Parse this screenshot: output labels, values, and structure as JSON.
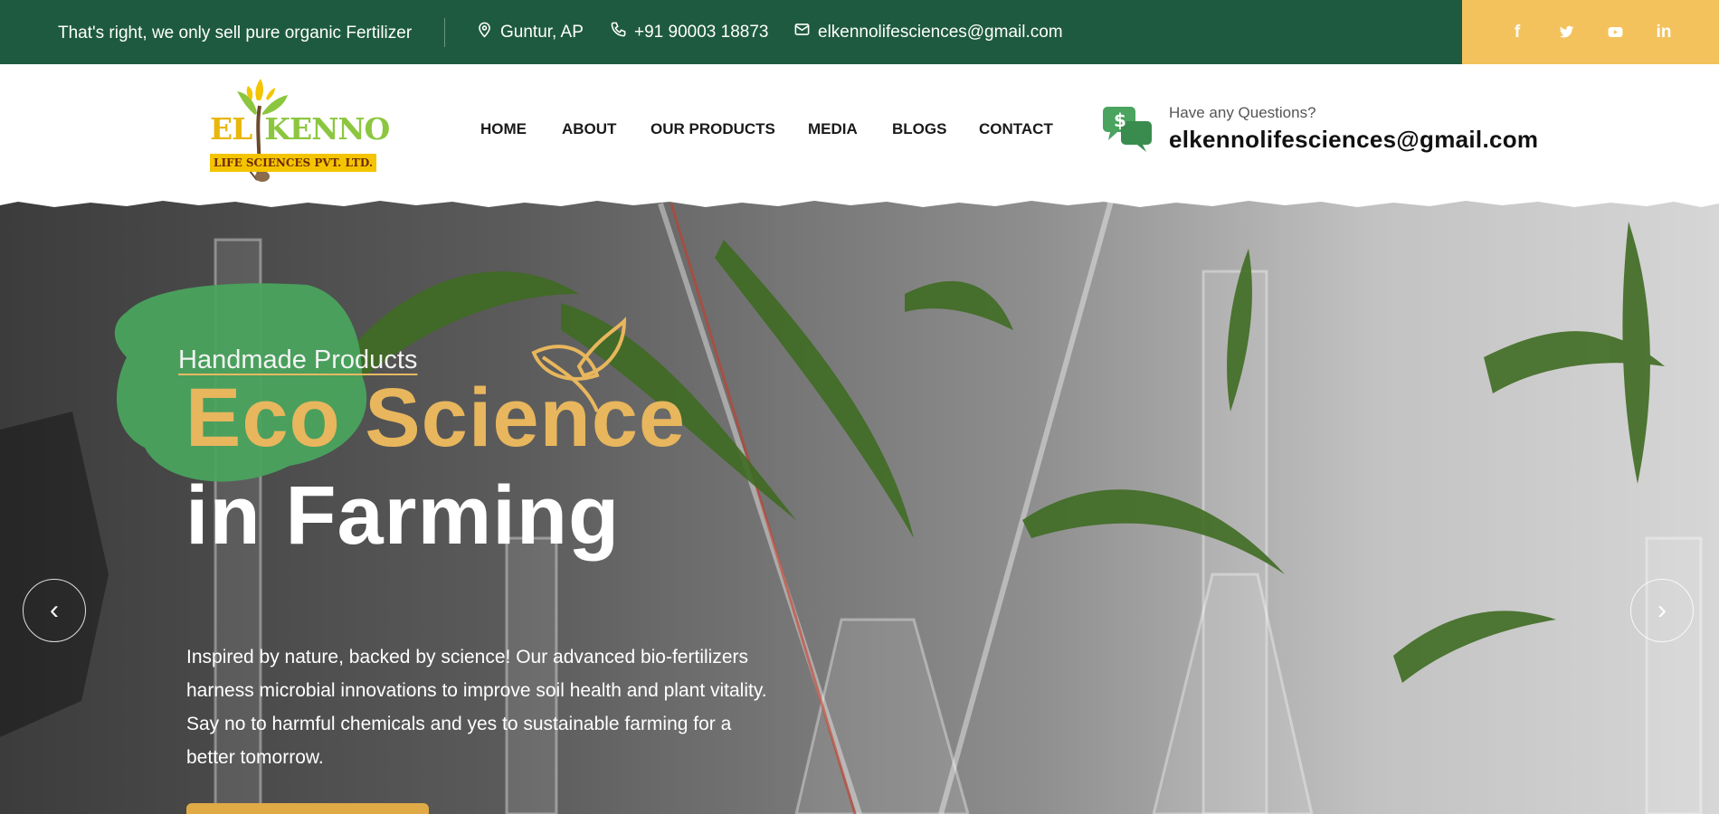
{
  "topbar": {
    "tagline": "That's right, we only sell pure organic Fertilizer",
    "location": "Guntur, AP",
    "phone": "+91 90003 18873",
    "email": "elkennolifesciences@gmail.com",
    "social_icons": [
      "facebook-icon",
      "twitter-icon",
      "youtube-icon",
      "linkedin-icon"
    ],
    "social_labels": {
      "facebook": "f",
      "twitter": "t",
      "youtube": "▶",
      "linkedin": "in"
    }
  },
  "header": {
    "logo": {
      "name_part1": "EL",
      "name_part2": "KENNO",
      "tagline": "LIFE SCIENCES PVT. LTD."
    },
    "nav": [
      "HOME",
      "ABOUT",
      "OUR PRODUCTS",
      "MEDIA",
      "BLOGS",
      "CONTACT"
    ],
    "question_label": "Have any Questions?",
    "question_email": "elkennolifesciences@gmail.com"
  },
  "hero": {
    "subtitle": "Handmade Products",
    "title_line1": "Eco Science",
    "title_line2": "in Farming",
    "description": "Inspired by nature, backed by science! Our advanced bio-fertilizers harness microbial innovations to improve soil health and plant vitality. Say no to harmful chemicals and yes to sustainable farming for a better tomorrow.",
    "prev_arrow": "‹",
    "next_arrow": "›"
  },
  "colors": {
    "topbar_bg": "#1e5a3f",
    "social_bg": "#f4c25c",
    "accent_gold": "#e8b65d",
    "accent_green": "#4aa35e"
  }
}
